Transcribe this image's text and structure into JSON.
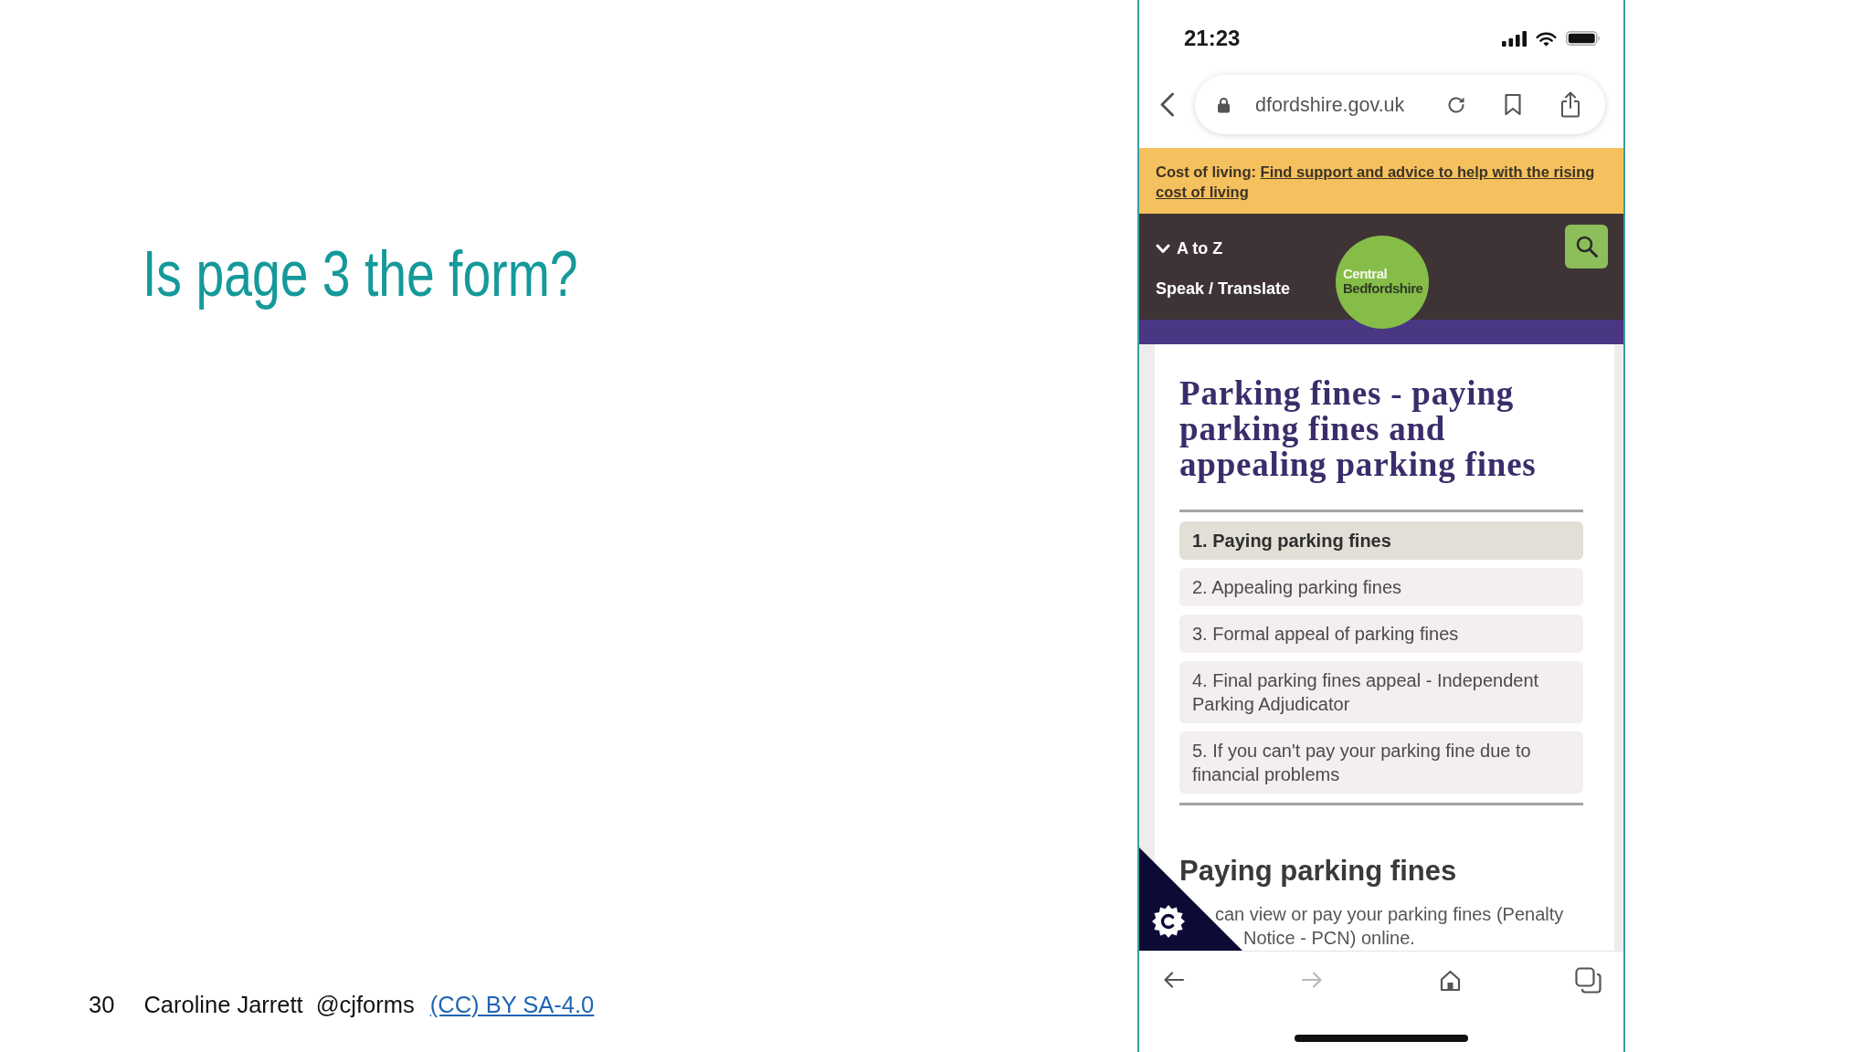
{
  "slide": {
    "title": "Is page 3 the form?",
    "footer": {
      "page_number": "30",
      "author": "Caroline Jarrett",
      "handle": "@cjforms",
      "license_link": "(CC) BY SA-4.0"
    }
  },
  "phone": {
    "status_bar": {
      "time": "21:23"
    },
    "address_bar": {
      "url": "dfordshire.gov.uk"
    },
    "banner": {
      "label": "Cost of living:",
      "link_lines": [
        "Find support and advice to help with the rising",
        "cost of living"
      ]
    },
    "site_header": {
      "menu_toggle": "A to Z",
      "speak_link": "Speak / Translate",
      "logo_lines": [
        "Central",
        "Bedfordshire"
      ]
    },
    "page": {
      "heading": "Parking fines - paying parking fines and appealing parking fines",
      "contents": [
        {
          "label": "1. Paying parking fines",
          "selected": true
        },
        {
          "label": "2. Appealing parking fines",
          "selected": false
        },
        {
          "label": "3. Formal appeal of parking fines",
          "selected": false
        },
        {
          "label": "4. Final parking fines appeal - Independent Parking Adjudicator",
          "selected": false
        },
        {
          "label": "5. If you can't pay your parking fine due to financial problems",
          "selected": false
        }
      ],
      "section_heading": "Paying parking fines",
      "paragraph_lines": [
        "can view or pay your parking fines (Penalty",
        "Notice - PCN) online."
      ]
    },
    "toolbar": [
      {
        "kind": "back",
        "disabled": false
      },
      {
        "kind": "forward",
        "disabled": true
      },
      {
        "kind": "home",
        "disabled": false
      },
      {
        "kind": "tabs",
        "disabled": false
      }
    ]
  }
}
